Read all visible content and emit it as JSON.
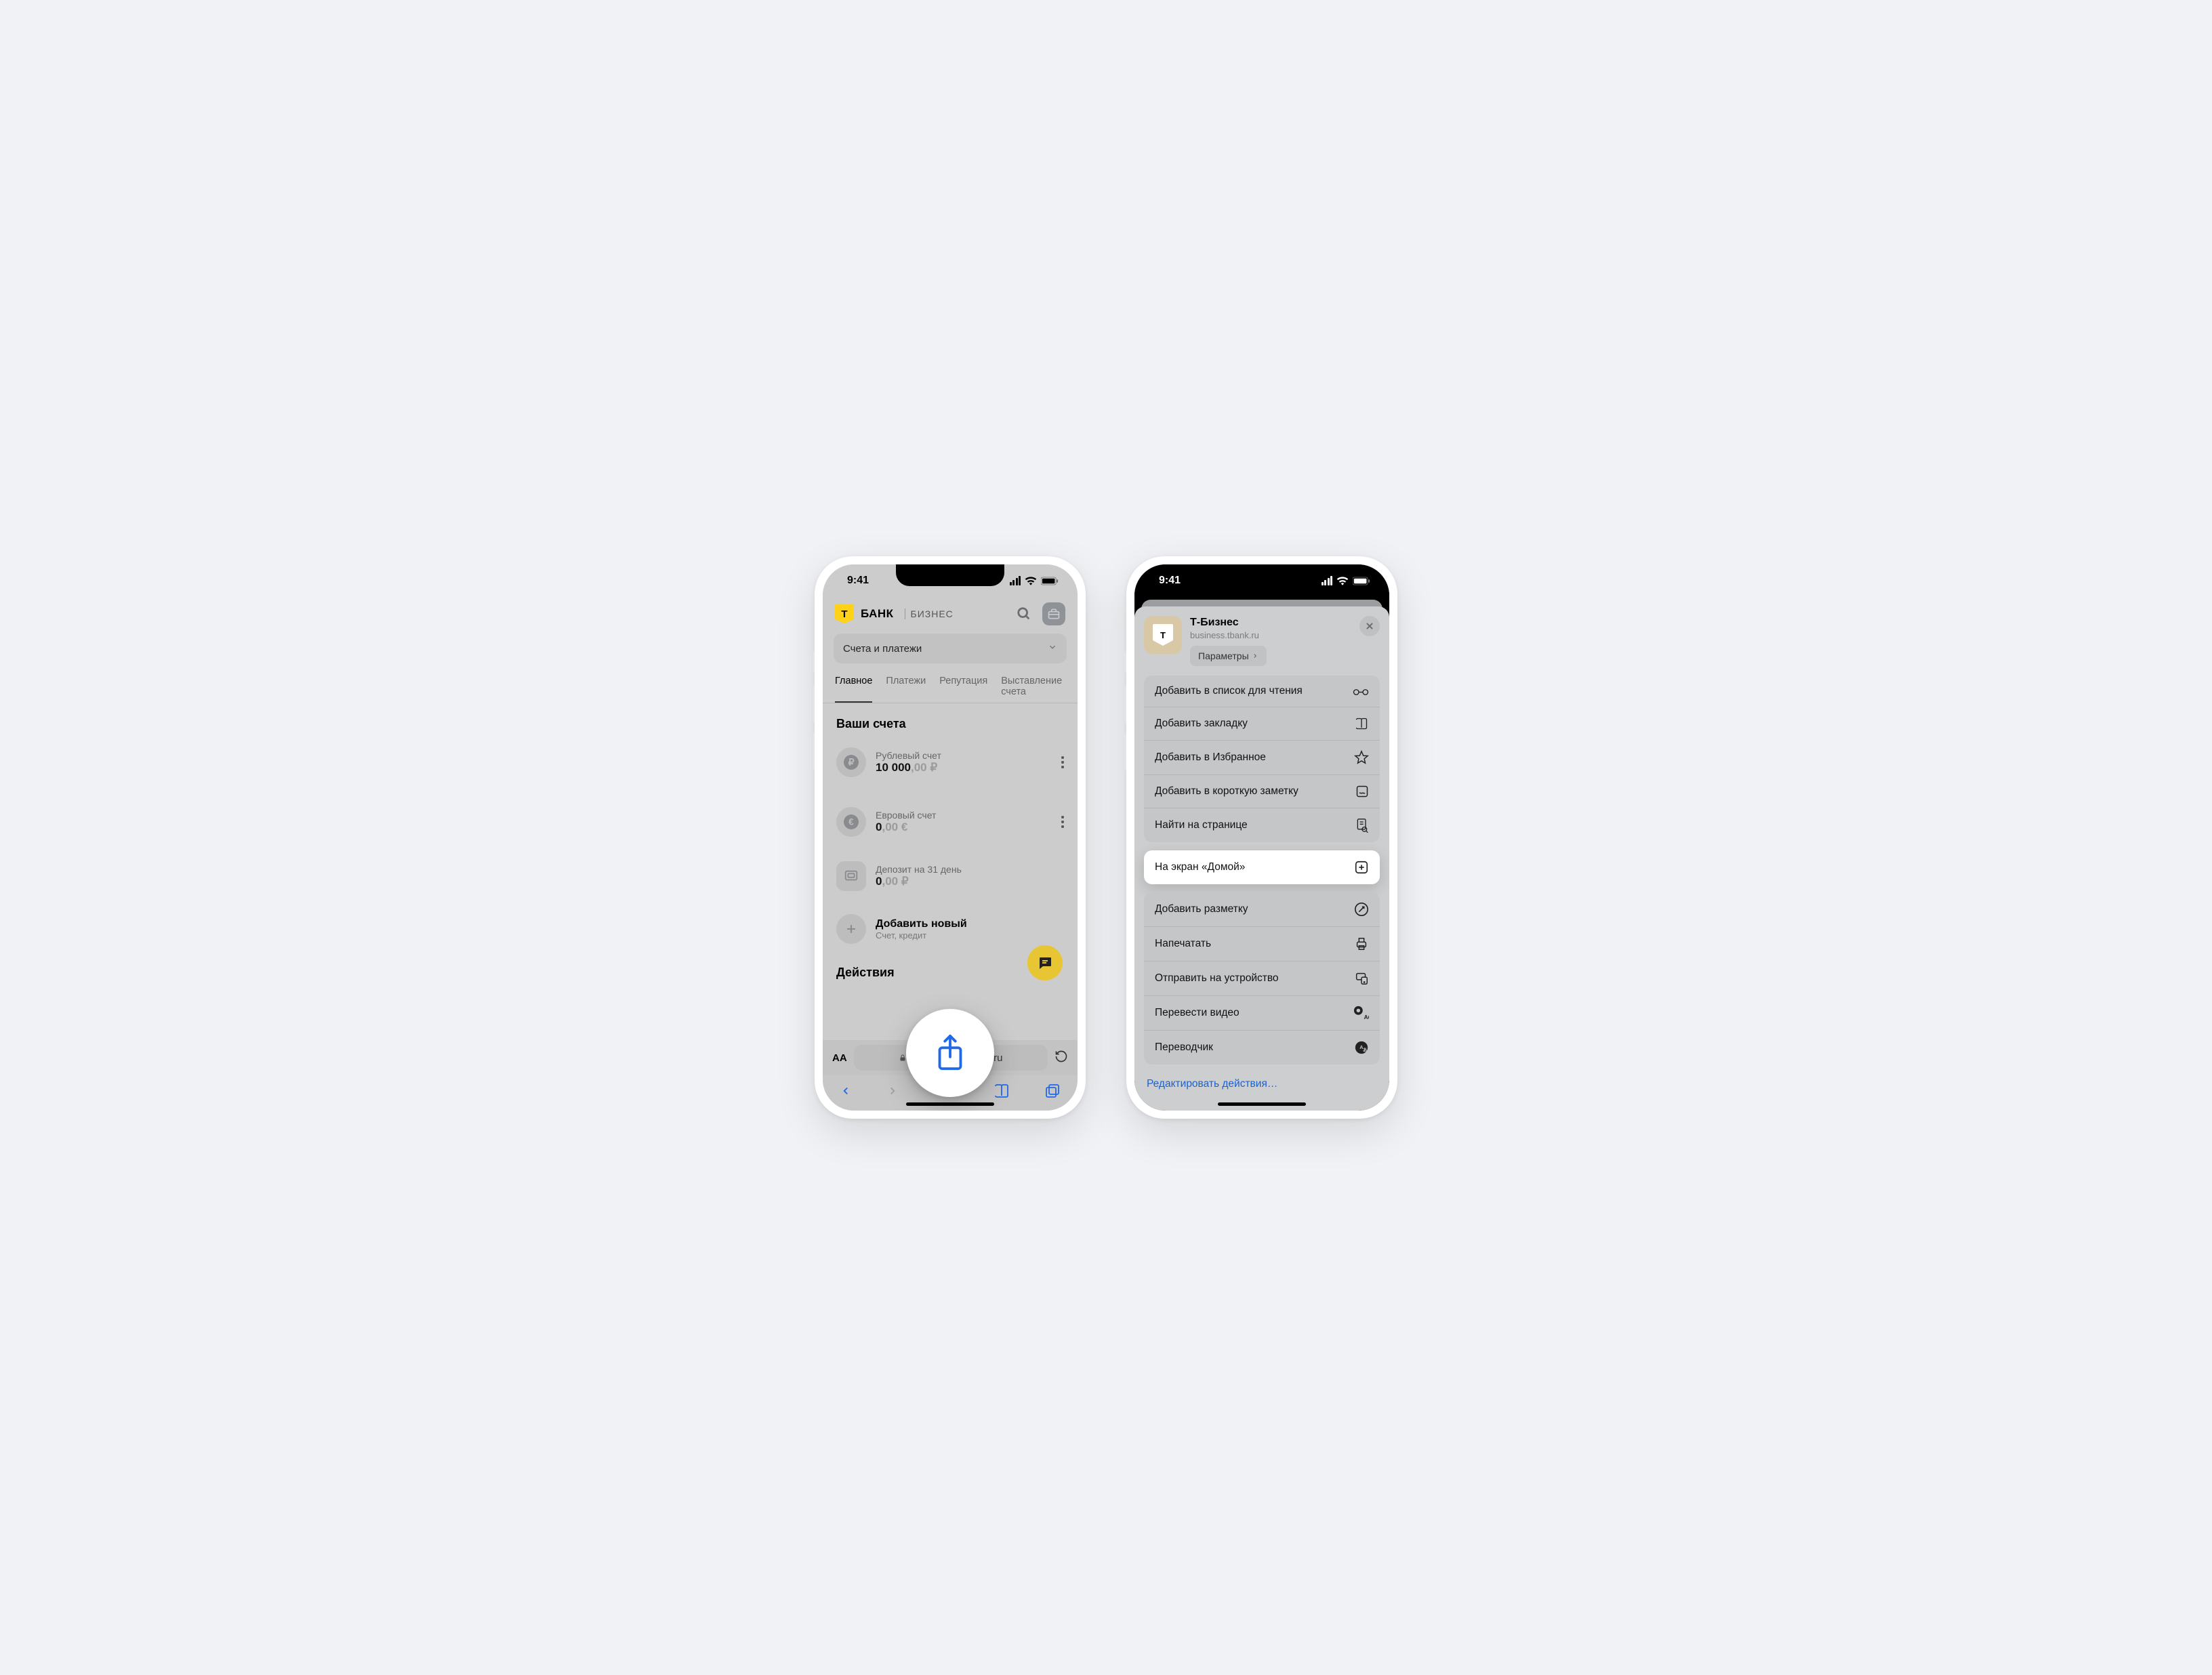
{
  "status": {
    "time": "9:41"
  },
  "p1": {
    "brand": "БАНК",
    "brand_sub": "БИЗНЕС",
    "dropdown": "Счета и платежи",
    "tabs": [
      "Главное",
      "Платежи",
      "Репутация",
      "Выставление счета"
    ],
    "accounts_title": "Ваши счета",
    "accounts": [
      {
        "label": "Рублевый счет",
        "amount_int": "10 000",
        "amount_dec": ",00 ₽",
        "icon": "ruble",
        "more": true
      },
      {
        "label": "Евровый счет",
        "amount_int": "0",
        "amount_dec": ",00 €",
        "icon": "euro",
        "more": true
      },
      {
        "label": "Депозит на 31 день",
        "amount_int": "0",
        "amount_dec": ",00 ₽",
        "icon": "safe",
        "more": false
      }
    ],
    "add_title": "Добавить новый",
    "add_sub": "Счет, кредит",
    "actions_title": "Действия",
    "url_text": "ru",
    "aa": "AA"
  },
  "p2": {
    "app_title": "Т-Бизнес",
    "app_url": "business.tbank.ru",
    "params_label": "Параметры",
    "group1": [
      {
        "label": "Добавить в список для чтения",
        "icon": "glasses"
      },
      {
        "label": "Добавить закладку",
        "icon": "book"
      },
      {
        "label": "Добавить в Избранное",
        "icon": "star"
      },
      {
        "label": "Добавить в короткую заметку",
        "icon": "note"
      },
      {
        "label": "Найти на странице",
        "icon": "find"
      }
    ],
    "highlight": {
      "label": "На экран «Домой»",
      "icon": "add-home"
    },
    "group2": [
      {
        "label": "Добавить разметку",
        "icon": "markup"
      },
      {
        "label": "Напечатать",
        "icon": "print"
      },
      {
        "label": "Отправить на устройство",
        "icon": "send-device"
      },
      {
        "label": "Перевести видео",
        "icon": "translate-video"
      },
      {
        "label": "Переводчик",
        "icon": "translator"
      }
    ],
    "edit_label": "Редактировать действия…"
  }
}
